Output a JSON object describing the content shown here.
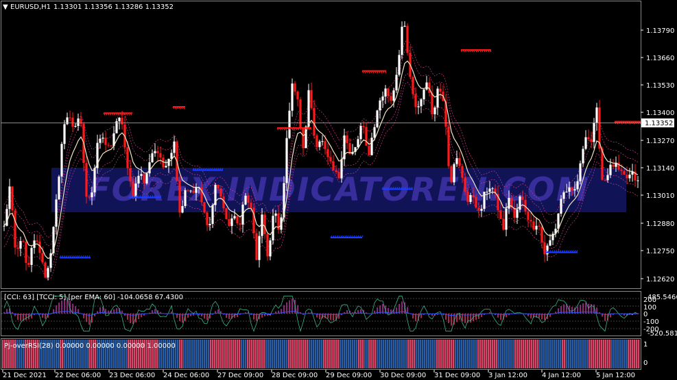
{
  "header": {
    "symbol_tf": "EURUSD,H1",
    "ohlc": "1.13301 1.13356 1.13286 1.13352"
  },
  "watermark": "FOREX-INDICATOREN.COM",
  "price_axis": {
    "labels": [
      "1.13790",
      "1.13660",
      "1.13530",
      "1.13400",
      "1.13270",
      "1.13140",
      "1.13010",
      "1.12880",
      "1.12750",
      "1.12620"
    ],
    "current_price": "1.13352"
  },
  "cci_panel": {
    "caption": "[CCI: 63] [TCCI: 5] [per EMA: 60]  -104.0658 67.4300",
    "labels": [
      "485.5466",
      "200",
      "100",
      "0",
      "-100",
      "-200",
      "-520.581"
    ]
  },
  "rsi_panel": {
    "caption": "Pj-overRSI(28) 0.00000 0.00000 0.00000 1.00000",
    "labels": [
      "1",
      "0"
    ]
  },
  "time_axis": {
    "labels": [
      "21 Dec 2021",
      "22 Dec 06:00",
      "23 Dec 06:00",
      "24 Dec 06:00",
      "27 Dec 09:00",
      "28 Dec 09:00",
      "29 Dec 09:00",
      "30 Dec 09:00",
      "31 Dec 09:00",
      "3 Jan 12:00",
      "4 Jan 12:00",
      "5 Jan 12:00"
    ]
  },
  "chart_data": {
    "type": "candlestick",
    "symbol": "EURUSD",
    "timeframe": "H1",
    "ylim": [
      1.1256,
      1.1392
    ],
    "colors": {
      "up": "#ffffff",
      "down": "#ff1a1a",
      "support": "#1e3cff",
      "resistance": "#ff1a1a",
      "ma": "#f5e6c8",
      "bands": "#d23a8c"
    },
    "anchor_prices": [
      1.1285,
      1.1305,
      1.127,
      1.1282,
      1.1262,
      1.128,
      1.1275,
      1.1262,
      1.1272,
      1.13,
      1.133,
      1.134,
      1.133,
      1.1338,
      1.1298,
      1.1303,
      1.1328,
      1.1325,
      1.1322,
      1.1333,
      1.1337,
      1.1312,
      1.13,
      1.1312,
      1.1305,
      1.132,
      1.1322,
      1.1313,
      1.1318,
      1.1325,
      1.129,
      1.1305,
      1.13,
      1.1305,
      1.1292,
      1.1285,
      1.1305,
      1.13,
      1.1285,
      1.129,
      1.1285,
      1.13,
      1.1295,
      1.127,
      1.129,
      1.127,
      1.1294,
      1.128,
      1.132,
      1.1355,
      1.1345,
      1.132,
      1.1352,
      1.1324,
      1.1327,
      1.1318,
      1.1312,
      1.1308,
      1.133,
      1.1318,
      1.1323,
      1.1335,
      1.1318,
      1.1332,
      1.1345,
      1.135,
      1.1345,
      1.136,
      1.1385,
      1.136,
      1.134,
      1.1345,
      1.1355,
      1.1338,
      1.1352,
      1.1345,
      1.1305,
      1.1318,
      1.131,
      1.1297,
      1.13,
      1.129,
      1.1302,
      1.1305,
      1.1296,
      1.1283,
      1.13,
      1.1288,
      1.13,
      1.1292,
      1.1285,
      1.1288,
      1.1272,
      1.1278,
      1.1285,
      1.13,
      1.1303,
      1.13,
      1.131,
      1.133,
      1.1325,
      1.134,
      1.1305,
      1.1312,
      1.1315,
      1.131,
      1.1308,
      1.131,
      1.1306
    ],
    "levels": [
      {
        "kind": "support",
        "price": 1.12705,
        "from": 87,
        "to": 132
      },
      {
        "kind": "resistance",
        "price": 1.1339,
        "from": 151,
        "to": 193
      },
      {
        "kind": "support",
        "price": 1.1299,
        "from": 188,
        "to": 235
      },
      {
        "kind": "resistance",
        "price": 1.1342,
        "from": 252,
        "to": 270
      },
      {
        "kind": "support",
        "price": 1.1312,
        "from": 281,
        "to": 325
      },
      {
        "kind": "resistance",
        "price": 1.1332,
        "from": 404,
        "to": 454
      },
      {
        "kind": "support",
        "price": 1.128,
        "from": 482,
        "to": 528
      },
      {
        "kind": "resistance",
        "price": 1.1359,
        "from": 528,
        "to": 563
      },
      {
        "kind": "support",
        "price": 1.1303,
        "from": 557,
        "to": 602
      },
      {
        "kind": "resistance",
        "price": 1.1369,
        "from": 672,
        "to": 716
      },
      {
        "kind": "support",
        "price": 1.1273,
        "from": 795,
        "to": 842
      },
      {
        "kind": "resistance",
        "price": 1.1335,
        "from": 896,
        "to": 934
      }
    ]
  }
}
